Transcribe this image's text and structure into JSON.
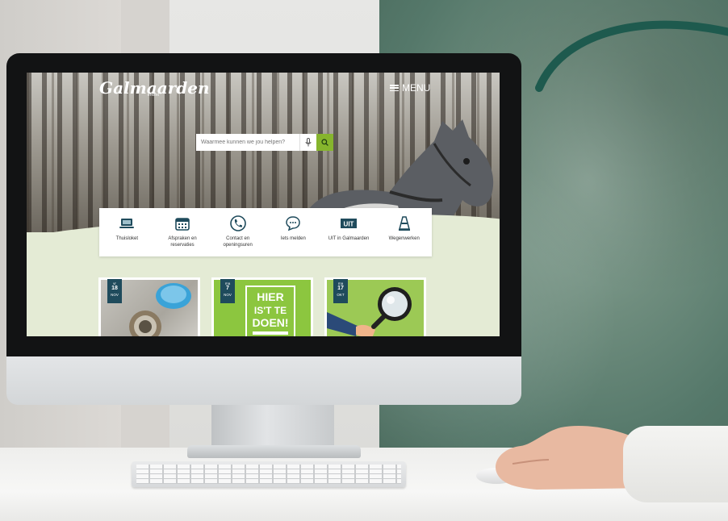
{
  "site": {
    "logo_text": "Galmaarden",
    "logo_sub": "erkent",
    "menu_label": "MENU"
  },
  "search": {
    "placeholder": "Waarmee kunnen we jou helpen?"
  },
  "quick_links": [
    {
      "label": "Thuisloket",
      "icon": "laptop-icon"
    },
    {
      "label": "Afspraken en reservaties",
      "icon": "calendar-icon"
    },
    {
      "label": "Contact en openingsuren",
      "icon": "phone-icon"
    },
    {
      "label": "Iets melden",
      "icon": "speech-bubble-icon"
    },
    {
      "label": "UIT in Galmaarden",
      "icon": "uit-icon"
    },
    {
      "label": "Wegenwerken",
      "icon": "traffic-cone-icon"
    }
  ],
  "cards": [
    {
      "day_name": "vr",
      "day": "18",
      "month": "NOV"
    },
    {
      "day_name": "ma",
      "day": "7",
      "month": "NOV",
      "poster_lines": [
        "HIER",
        "IS'T TE",
        "DOEN!"
      ]
    },
    {
      "day_name": "ma",
      "day": "17",
      "month": "OKT"
    }
  ],
  "colors": {
    "accent_green": "#86b52d",
    "date_badge": "#1f4b5c",
    "deco_arc": "#1e5a4e"
  }
}
